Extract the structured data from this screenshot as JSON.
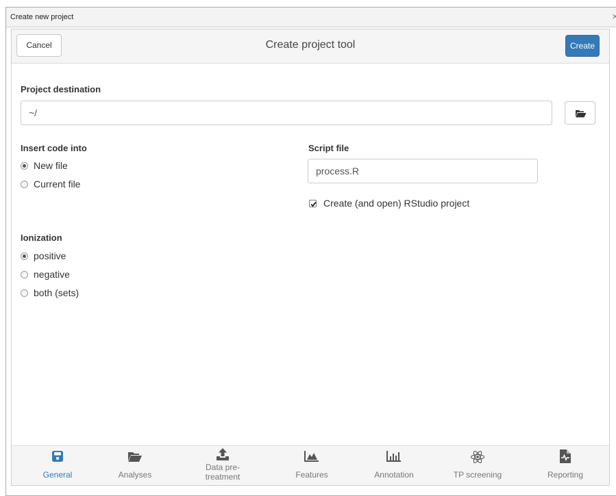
{
  "window": {
    "title": "Create new project",
    "close_glyph": "×"
  },
  "header": {
    "cancel_label": "Cancel",
    "title": "Create project tool",
    "create_label": "Create"
  },
  "destination": {
    "label": "Project destination",
    "value": "~/",
    "browse_icon": "folder-open-icon"
  },
  "insert_code": {
    "label": "Insert code into",
    "options": [
      {
        "label": "New file",
        "checked": true
      },
      {
        "label": "Current file",
        "checked": false
      }
    ]
  },
  "script_file": {
    "label": "Script file",
    "value": "process.R",
    "rstudio_checkbox": {
      "label": "Create (and open) RStudio project",
      "checked": true
    }
  },
  "ionization": {
    "label": "Ionization",
    "options": [
      {
        "label": "positive",
        "checked": true
      },
      {
        "label": "negative",
        "checked": false
      },
      {
        "label": "both (sets)",
        "checked": false
      }
    ]
  },
  "tabs": [
    {
      "label": "General",
      "icon": "save-icon",
      "active": true
    },
    {
      "label": "Analyses",
      "icon": "folder-open-icon",
      "active": false
    },
    {
      "label": "Data pre-treatment",
      "icon": "upload-icon",
      "active": false
    },
    {
      "label": "Features",
      "icon": "area-chart-icon",
      "active": false
    },
    {
      "label": "Annotation",
      "icon": "bar-chart-icon",
      "active": false
    },
    {
      "label": "TP screening",
      "icon": "atom-icon",
      "active": false
    },
    {
      "label": "Reporting",
      "icon": "file-medical-icon",
      "active": false
    }
  ],
  "colors": {
    "accent": "#337ab7",
    "tab_inactive": "#777777"
  }
}
